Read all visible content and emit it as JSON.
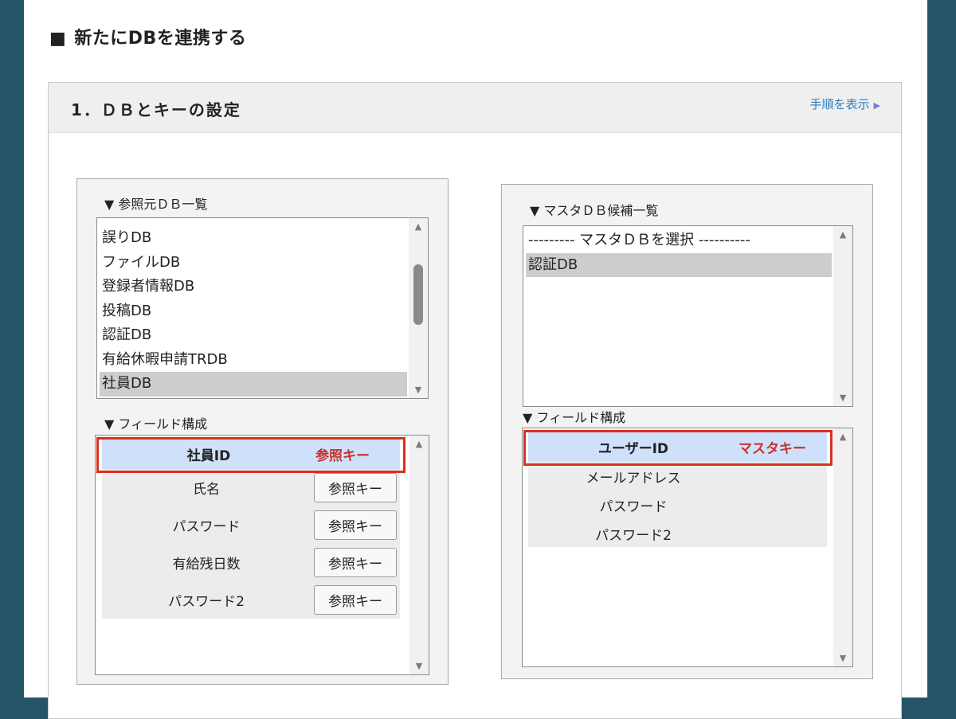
{
  "section": {
    "marker": "■",
    "title": "新たにDBを連携する"
  },
  "card": {
    "title": "1．ＤＢとキーの設定",
    "show_steps": "手順を表示",
    "show_steps_arrow": "▶"
  },
  "ref_panel": {
    "list_label": "▼ 参照元ＤＢ一覧",
    "db_list": [
      {
        "label": "誤りDB",
        "selected": false
      },
      {
        "label": "ファイルDB",
        "selected": false
      },
      {
        "label": "登録者情報DB",
        "selected": false
      },
      {
        "label": "投稿DB",
        "selected": false
      },
      {
        "label": "認証DB",
        "selected": false
      },
      {
        "label": "有給休暇申請TRDB",
        "selected": false
      },
      {
        "label": "社員DB",
        "selected": true
      }
    ],
    "field_label": "▼ フィールド構成",
    "key_field": {
      "name": "社員ID",
      "key_label": "参照キー"
    },
    "fields": [
      {
        "name": "氏名",
        "button": "参照キー"
      },
      {
        "name": "パスワード",
        "button": "参照キー"
      },
      {
        "name": "有給残日数",
        "button": "参照キー"
      },
      {
        "name": "パスワード2",
        "button": "参照キー"
      }
    ]
  },
  "master_panel": {
    "list_label": "▼ マスタＤＢ候補一覧",
    "db_list": [
      {
        "label": "--------- マスタＤＢを選択 ----------",
        "selected": false
      },
      {
        "label": "認証DB",
        "selected": true
      }
    ],
    "field_label": "▼ フィールド構成",
    "key_field": {
      "name": "ユーザーID",
      "key_label": "マスタキー"
    },
    "fields": [
      {
        "name": "メールアドレス"
      },
      {
        "name": "パスワード"
      },
      {
        "name": "パスワード2"
      }
    ]
  },
  "icons": {
    "scroll_up": "▲",
    "scroll_down": "▼"
  }
}
